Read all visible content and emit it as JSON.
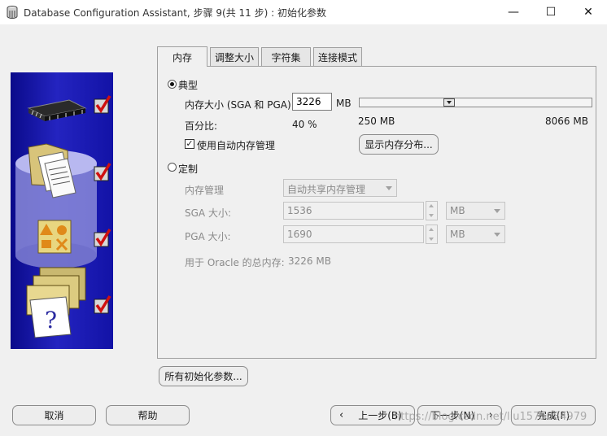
{
  "window": {
    "title": "Database Configuration Assistant, 步骤 9(共 11 步) : 初始化参数",
    "minimize": "—",
    "maximize": "☐",
    "close": "✕"
  },
  "tabs": [
    {
      "label": "内存",
      "active": true
    },
    {
      "label": "调整大小",
      "active": false
    },
    {
      "label": "字符集",
      "active": false
    },
    {
      "label": "连接模式",
      "active": false
    }
  ],
  "typical": {
    "radio_label": "典型",
    "memory_size_label": "内存大小 (SGA 和 PGA):",
    "memory_size_value": "3226",
    "memory_unit": "MB",
    "slider_min": "250 MB",
    "slider_max": "8066 MB",
    "percent_label": "百分比:",
    "percent_value": "40 %",
    "auto_memory_label": "使用自动内存管理",
    "auto_memory_checked": true,
    "show_distribution_button": "显示内存分布..."
  },
  "custom": {
    "radio_label": "定制",
    "memory_mgmt_label": "内存管理",
    "memory_mgmt_value": "自动共享内存管理",
    "sga_label": "SGA 大小:",
    "sga_value": "1536",
    "sga_unit": "MB",
    "pga_label": "PGA 大小:",
    "pga_value": "1690",
    "pga_unit": "MB",
    "total_label": "用于 Oracle 的总内存:",
    "total_value": "3226 MB"
  },
  "all_params_button": "所有初始化参数...",
  "footer": {
    "cancel": "取消",
    "help": "帮助",
    "back": "上一步(B)",
    "next": "下一步(N)",
    "finish": "完成(F)"
  },
  "watermark": "https://blog.csdn.net/liu1575084979"
}
